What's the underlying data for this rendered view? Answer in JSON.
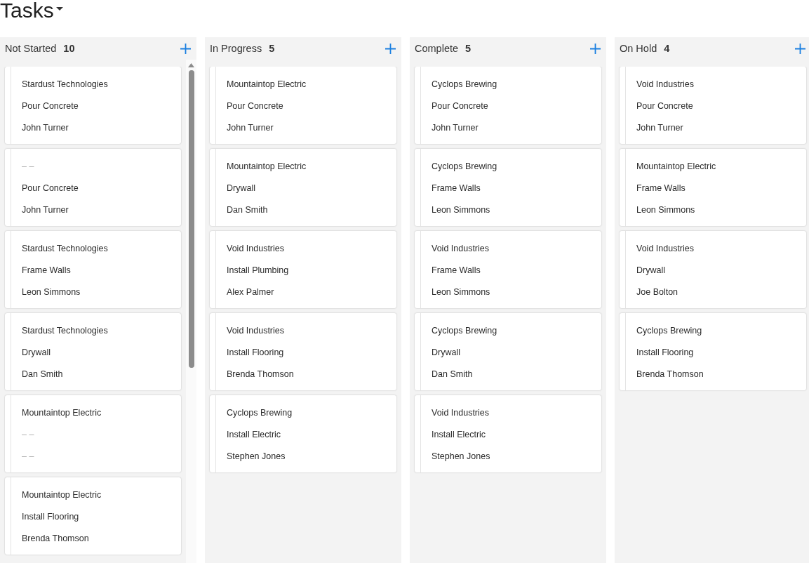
{
  "title": "Tasks",
  "columns": [
    {
      "name": "Not Started",
      "count": "10",
      "scrollable": true,
      "cards": [
        {
          "lines": [
            {
              "text": "Stardust Technologies",
              "muted": false
            },
            {
              "text": "Pour Concrete",
              "muted": false
            },
            {
              "text": "John Turner",
              "muted": false
            }
          ]
        },
        {
          "lines": [
            {
              "text": "– –",
              "muted": true
            },
            {
              "text": "Pour Concrete",
              "muted": false
            },
            {
              "text": "John Turner",
              "muted": false
            }
          ]
        },
        {
          "lines": [
            {
              "text": "Stardust Technologies",
              "muted": false
            },
            {
              "text": "Frame Walls",
              "muted": false
            },
            {
              "text": "Leon Simmons",
              "muted": false
            }
          ]
        },
        {
          "lines": [
            {
              "text": "Stardust Technologies",
              "muted": false
            },
            {
              "text": "Drywall",
              "muted": false
            },
            {
              "text": "Dan Smith",
              "muted": false
            }
          ]
        },
        {
          "lines": [
            {
              "text": "Mountaintop Electric",
              "muted": false
            },
            {
              "text": "– –",
              "muted": true
            },
            {
              "text": "– –",
              "muted": true
            }
          ]
        },
        {
          "lines": [
            {
              "text": "Mountaintop Electric",
              "muted": false
            },
            {
              "text": "Install Flooring",
              "muted": false
            },
            {
              "text": "Brenda Thomson",
              "muted": false
            }
          ]
        }
      ]
    },
    {
      "name": "In Progress",
      "count": "5",
      "scrollable": false,
      "cards": [
        {
          "lines": [
            {
              "text": "Mountaintop Electric",
              "muted": false
            },
            {
              "text": "Pour Concrete",
              "muted": false
            },
            {
              "text": "John Turner",
              "muted": false
            }
          ]
        },
        {
          "lines": [
            {
              "text": "Mountaintop Electric",
              "muted": false
            },
            {
              "text": "Drywall",
              "muted": false
            },
            {
              "text": "Dan Smith",
              "muted": false
            }
          ]
        },
        {
          "lines": [
            {
              "text": "Void Industries",
              "muted": false
            },
            {
              "text": "Install Plumbing",
              "muted": false
            },
            {
              "text": "Alex Palmer",
              "muted": false
            }
          ]
        },
        {
          "lines": [
            {
              "text": "Void Industries",
              "muted": false
            },
            {
              "text": "Install Flooring",
              "muted": false
            },
            {
              "text": "Brenda Thomson",
              "muted": false
            }
          ]
        },
        {
          "lines": [
            {
              "text": "Cyclops Brewing",
              "muted": false
            },
            {
              "text": "Install Electric",
              "muted": false
            },
            {
              "text": "Stephen Jones",
              "muted": false
            }
          ]
        }
      ]
    },
    {
      "name": "Complete",
      "count": "5",
      "scrollable": false,
      "cards": [
        {
          "lines": [
            {
              "text": "Cyclops Brewing",
              "muted": false
            },
            {
              "text": "Pour Concrete",
              "muted": false
            },
            {
              "text": "John Turner",
              "muted": false
            }
          ]
        },
        {
          "lines": [
            {
              "text": "Cyclops Brewing",
              "muted": false
            },
            {
              "text": "Frame Walls",
              "muted": false
            },
            {
              "text": "Leon Simmons",
              "muted": false
            }
          ]
        },
        {
          "lines": [
            {
              "text": "Void Industries",
              "muted": false
            },
            {
              "text": "Frame Walls",
              "muted": false
            },
            {
              "text": "Leon Simmons",
              "muted": false
            }
          ]
        },
        {
          "lines": [
            {
              "text": "Cyclops Brewing",
              "muted": false
            },
            {
              "text": "Drywall",
              "muted": false
            },
            {
              "text": "Dan Smith",
              "muted": false
            }
          ]
        },
        {
          "lines": [
            {
              "text": "Void Industries",
              "muted": false
            },
            {
              "text": "Install Electric",
              "muted": false
            },
            {
              "text": "Stephen Jones",
              "muted": false
            }
          ]
        }
      ]
    },
    {
      "name": "On Hold",
      "count": "4",
      "scrollable": false,
      "cards": [
        {
          "lines": [
            {
              "text": "Void Industries",
              "muted": false
            },
            {
              "text": "Pour Concrete",
              "muted": false
            },
            {
              "text": "John Turner",
              "muted": false
            }
          ]
        },
        {
          "lines": [
            {
              "text": "Mountaintop Electric",
              "muted": false
            },
            {
              "text": "Frame Walls",
              "muted": false
            },
            {
              "text": "Leon Simmons",
              "muted": false
            }
          ]
        },
        {
          "lines": [
            {
              "text": "Void Industries",
              "muted": false
            },
            {
              "text": "Drywall",
              "muted": false
            },
            {
              "text": "Joe Bolton",
              "muted": false
            }
          ]
        },
        {
          "lines": [
            {
              "text": "Cyclops Brewing",
              "muted": false
            },
            {
              "text": "Install Flooring",
              "muted": false
            },
            {
              "text": "Brenda Thomson",
              "muted": false
            }
          ]
        }
      ]
    }
  ]
}
